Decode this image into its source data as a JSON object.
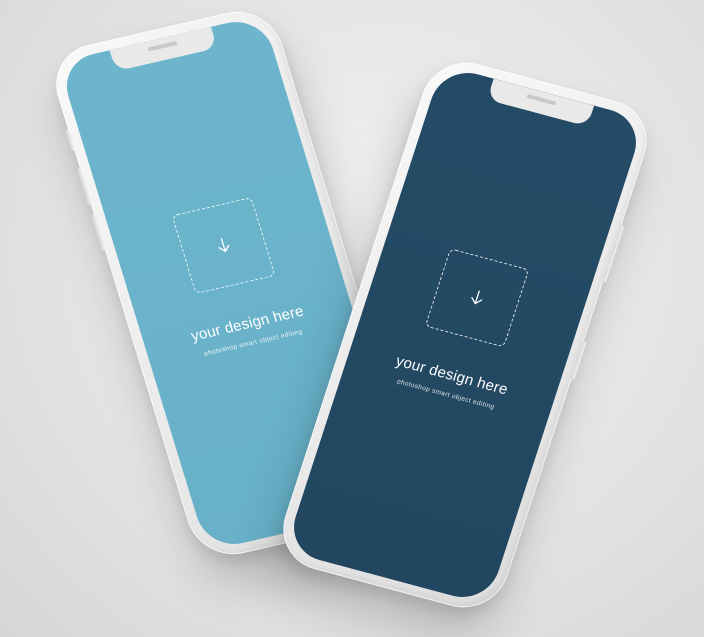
{
  "phones": [
    {
      "id": "left",
      "screen_color": "#6cb5cc",
      "icon": "arrow-down-icon",
      "title": "your design here",
      "subtitle": "photoshop smart object editing"
    },
    {
      "id": "right",
      "screen_color": "#244b66",
      "icon": "arrow-down-icon",
      "title": "your design here",
      "subtitle": "photoshop smart object editing"
    }
  ],
  "colors": {
    "background": "#e4e4e4",
    "frame": "#ececec",
    "screen_light_blue": "#6cb5cc",
    "screen_dark_blue": "#244b66"
  }
}
